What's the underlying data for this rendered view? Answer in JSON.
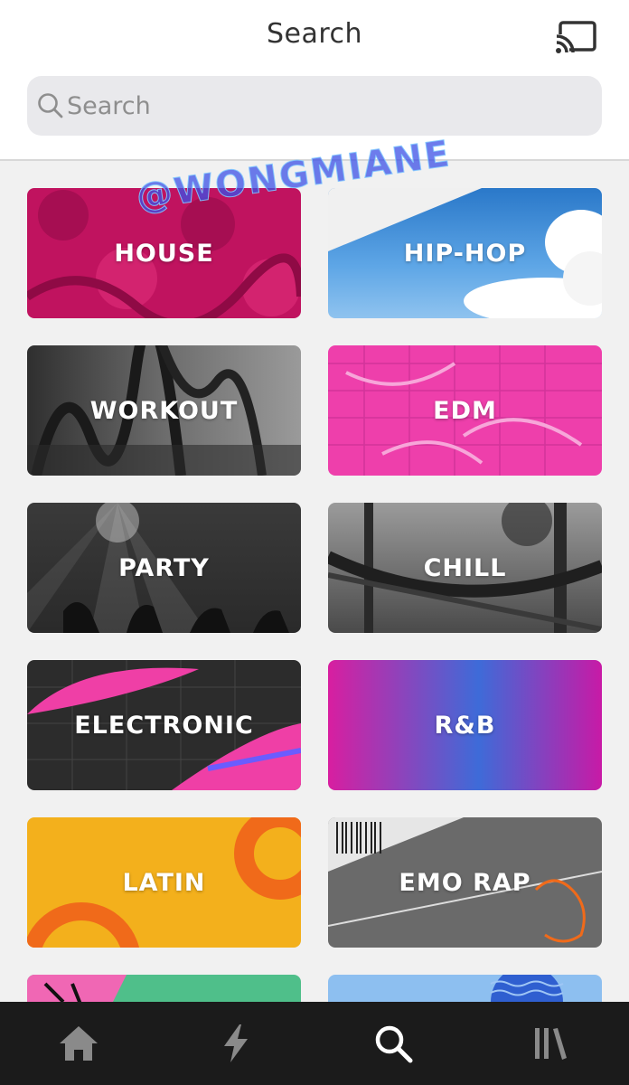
{
  "header": {
    "title": "Search",
    "cast_icon": "cast-icon"
  },
  "search": {
    "placeholder": "Search",
    "value": "",
    "icon": "search-icon"
  },
  "watermark": "@WONGMIANE",
  "genres": [
    {
      "label": "HOUSE"
    },
    {
      "label": "HIP-HOP"
    },
    {
      "label": "WORKOUT"
    },
    {
      "label": "EDM"
    },
    {
      "label": "PARTY"
    },
    {
      "label": "CHILL"
    },
    {
      "label": "ELECTRONIC"
    },
    {
      "label": "R&B"
    },
    {
      "label": "LATIN"
    },
    {
      "label": "EMO RAP"
    }
  ],
  "tabbar": {
    "items": [
      {
        "icon": "home-icon"
      },
      {
        "icon": "lightning-icon"
      },
      {
        "icon": "search-icon",
        "active": true
      },
      {
        "icon": "library-icon"
      }
    ]
  },
  "colors": {
    "house": "#c0135f",
    "edm": "#ee3fab",
    "latin": "#f3b01c",
    "rb_start": "#d81ea0",
    "rb_mid": "#3e6bd8",
    "tabbar": "#1b1b1b"
  }
}
